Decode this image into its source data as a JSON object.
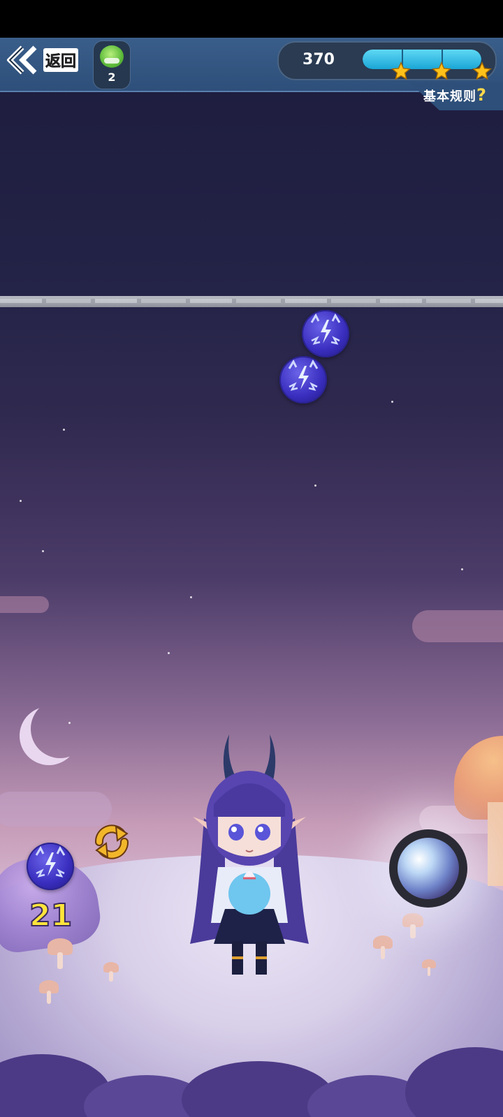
{
  "header": {
    "back_label": "返回",
    "pet_count": "2",
    "score": "370",
    "progress_fraction": 1.0,
    "stars_earned": 3,
    "rules_label": "基本规则",
    "rules_question": "?"
  },
  "hud": {
    "ammo_count": "21",
    "current_bubble": "lightning-bubble",
    "swap_icon": "swap-arrows-icon",
    "fire_icon": "crystal-orb-icon"
  },
  "board": {
    "bubbles": [
      "lightning-bubble",
      "lightning-bubble"
    ]
  },
  "colors": {
    "header_bg": "#2d4f7a",
    "progress": "#1aa6d6",
    "star": "#ffc21a",
    "ammo_text": "#ffe43a",
    "bubble": "#3a2fc0"
  }
}
